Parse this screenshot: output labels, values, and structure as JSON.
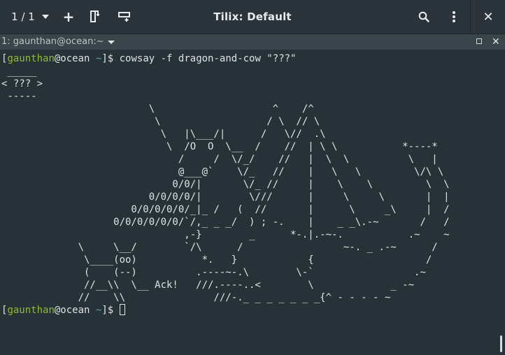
{
  "header": {
    "session_counter": "1 / 1",
    "add_label": "+",
    "title": "Tilix: Default",
    "close_label": "✕"
  },
  "terminal_tab": {
    "label": "1: gaunthan@ocean:~",
    "close_label": "✕"
  },
  "terminal": {
    "prompt": {
      "open": "[",
      "user": "gaunthan",
      "at_host": "@ocean",
      "cwd": "~",
      "close": "]$ "
    },
    "command": "cowsay -f dragon-and-cow \"???\"",
    "output": " _____\n< ??? >\n -----\n                         \\                    ^    /^\n                          \\                  / \\  // \\\n                           \\   |\\___/|      /   \\//  .\\\n                            \\  /O  O  \\__  /    //  | \\ \\           *----*\n                              /     /  \\/_/    //   |  \\  \\          \\   |\n                              @___@`    \\/_   //    |   \\   \\         \\/\\ \\\n                             0/0/|       \\/_ //     |    \\    \\         \\  \\\n                         0/0/0/0/|        \\///      |     \\     \\       |  |\n                      0/0/0/0/0/_|_ /   (  //       |      \\     _\\     |  /\n                   0/0/0/0/0/0/`/,_ _ _/  ) ; -.    |    _ _\\.-~       /   /\n                               ,-}        _      *-.|.-~-.           .~    ~\n             \\     \\__/        `/\\      /                 ~-. _ .-~      /\n              \\____(oo)           *.   }            {                   /\n              (    (--)          .----~-.\\        \\-`                 .~\n              //__\\\\  \\__ Ack!   ///.----..<        \\             _ -~\n             //    \\\\               ///-._ _ _ _ _ _ _{^ - - - - ~"
  },
  "icons": {
    "session_dropdown": "chevron-down-icon",
    "add_terminal": "plus-icon",
    "split_horizontal": "split-right-icon",
    "split_vertical": "split-down-icon",
    "search": "search-icon",
    "menu": "kebab-menu-icon",
    "close_window": "close-icon",
    "terminal_menu": "chevron-down-icon",
    "maximize_terminal": "maximize-icon",
    "close_terminal": "close-icon"
  },
  "colors": {
    "background": "#263238",
    "headerbar": "#2b343a",
    "termbar": "#39444b",
    "user": "#8fbc2b",
    "path": "#47b2a6",
    "foreground": "#dde3e6"
  }
}
